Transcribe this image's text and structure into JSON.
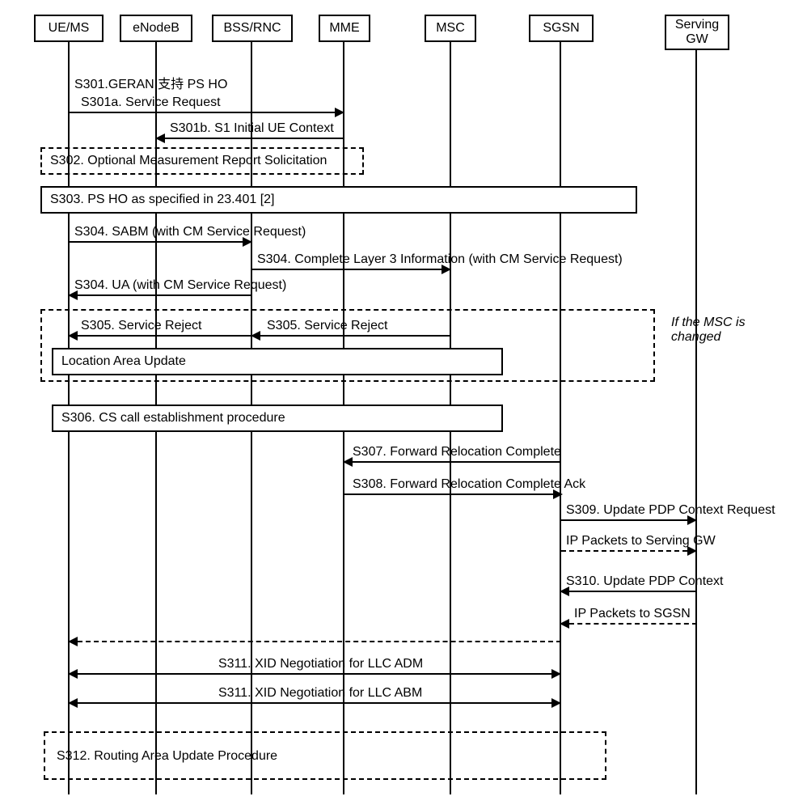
{
  "lifelines": {
    "ue": "UE/MS",
    "enodeb": "eNodeB",
    "bss": "BSS/RNC",
    "mme": "MME",
    "msc": "MSC",
    "sgsn": "SGSN",
    "sgw": "Serving GW"
  },
  "messages": {
    "s301": "S301.GERAN 支持 PS HO",
    "s301a": "S301a. Service Request",
    "s301b": "S301b. S1 Initial UE Context",
    "s302": "S302. Optional Measurement Report Solicitation",
    "s303": "S303. PS HO as specified in 23.401 [2]",
    "s304a": "S304. SABM (with CM Service Request)",
    "s304b": "S304. Complete Layer 3 Information (with CM Service Request)",
    "s304c": "S304. UA (with CM Service Request)",
    "s305a": "S305. Service Reject",
    "s305b": "S305. Service Reject",
    "lau": "Location Area Update",
    "msc_changed": "If the MSC is changed",
    "s306": "S306. CS call establishment procedure",
    "s307": "S307. Forward Relocation Complete",
    "s308": "S308. Forward Relocation Complete Ack",
    "s309": "S309. Update PDP Context Request",
    "ip_sgw": "IP Packets to Serving GW",
    "s310": "S310. Update PDP Context",
    "ip_sgsn": "IP Packets to SGSN",
    "s311a": "S311. XID Negotiation for LLC ADM",
    "s311b": "S311. XID Negotiation for LLC ABM",
    "s312": "S312. Routing Area Update Procedure"
  }
}
